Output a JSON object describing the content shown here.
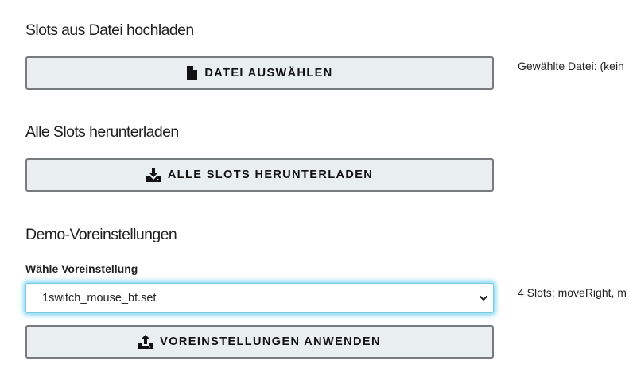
{
  "upload": {
    "heading": "Slots aus Datei hochladen",
    "button_label": "DATEI AUSWÄHLEN",
    "file_status": "Gewählte Datei: (kein"
  },
  "download": {
    "heading": "Alle Slots herunterladen",
    "button_label": "ALLE SLOTS HERUNTERLADEN"
  },
  "demo": {
    "heading": "Demo-Voreinstellungen",
    "select_label": "Wähle Voreinstellung",
    "selected_value": "1switch_mouse_bt.set",
    "preset_info": "4 Slots: moveRight, m",
    "apply_label": "VOREINSTELLUNGEN ANWENDEN"
  },
  "icons": {
    "file": "file-icon",
    "download": "download-icon",
    "upload": "upload-icon",
    "dropdown": "chevron-down-icon"
  }
}
